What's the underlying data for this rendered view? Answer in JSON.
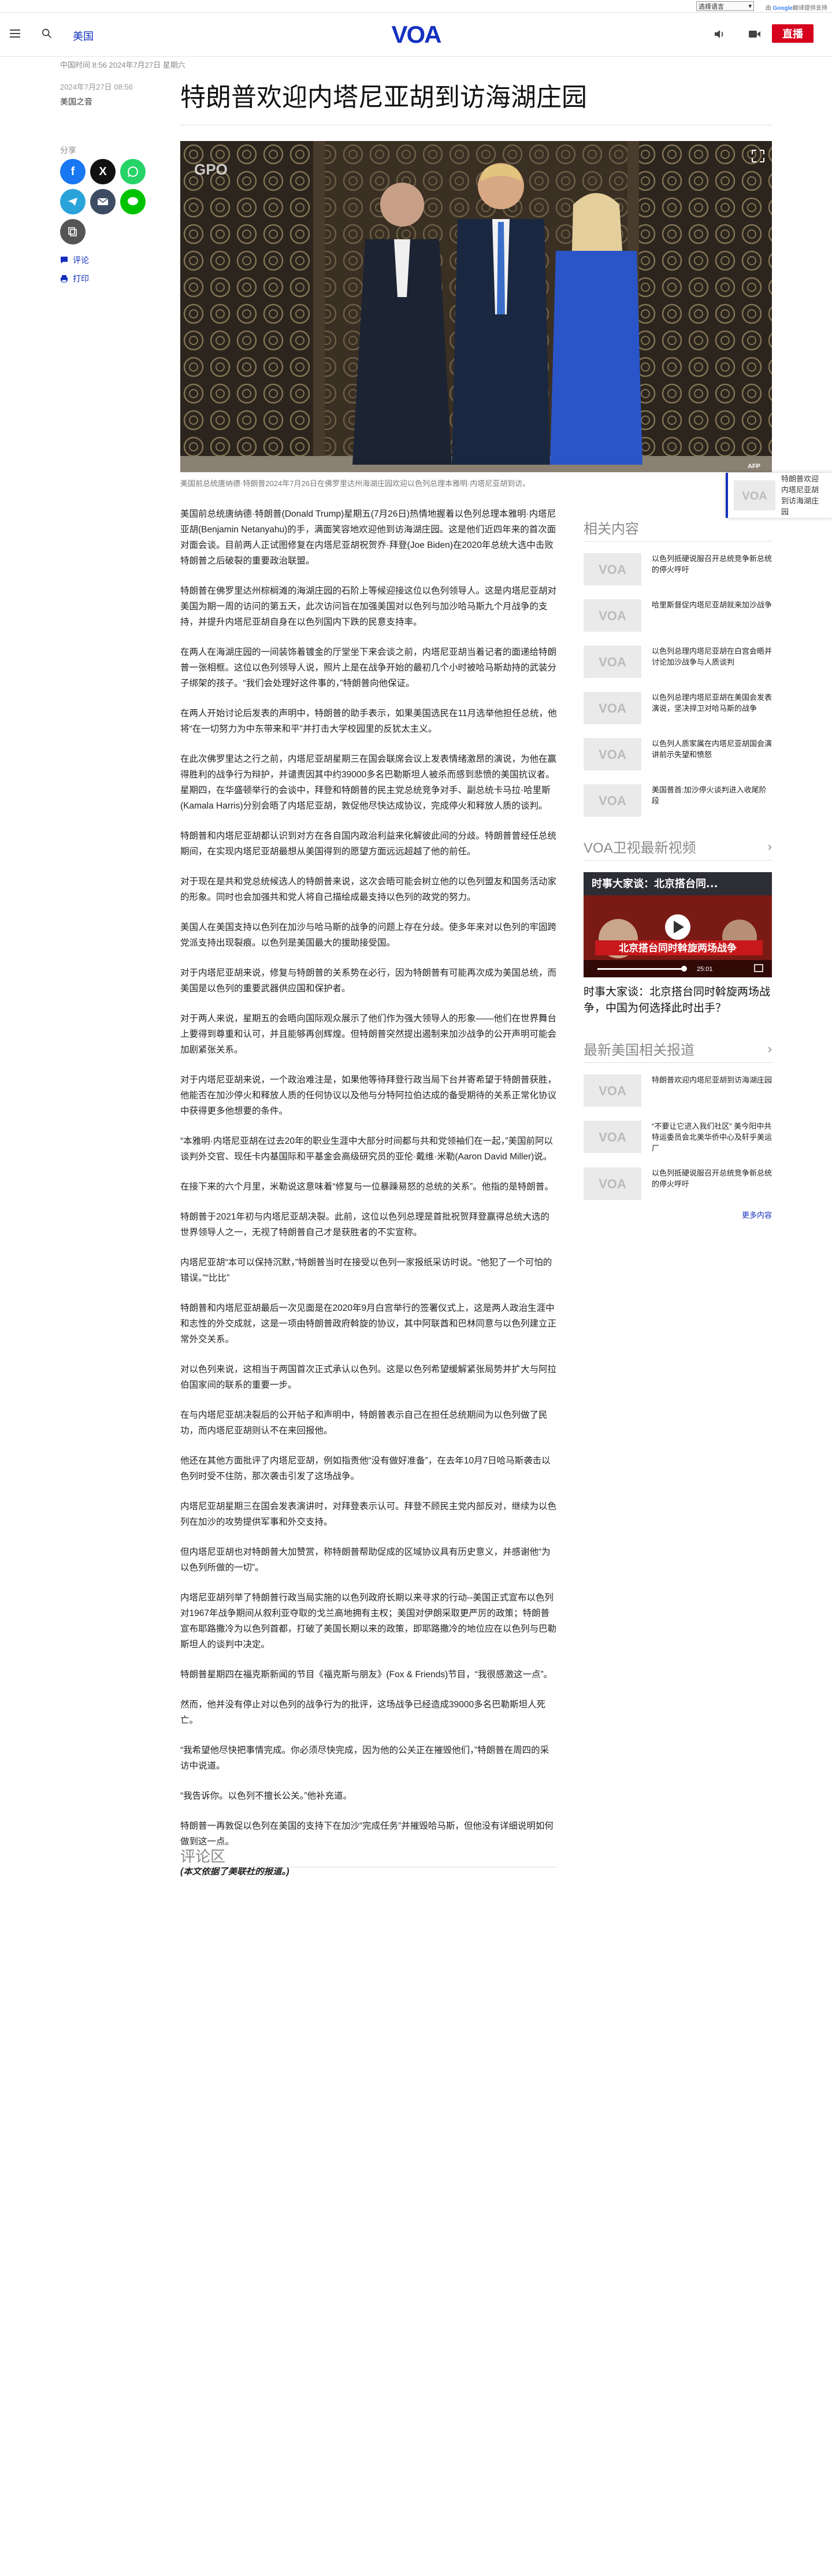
{
  "translate": {
    "select_label": "选择语言",
    "credit_prefix": "由",
    "credit_brand": "Google",
    "credit_suffix": "翻译提供支持"
  },
  "header": {
    "section": "美国",
    "logo": "VOA",
    "live_label": "直播"
  },
  "article": {
    "top_time": "中国时间 8:56 2024年7月27日 星期六",
    "date": "2024年7月27日 08:56",
    "author": "美国之音",
    "title": "特朗普欢迎内塔尼亚胡到访海湖庄园",
    "image_watermark": "GPO",
    "image_credit": "AFP",
    "caption": "美国前总统唐纳德·特朗普2024年7月26日在佛罗里达州海湖庄园欢迎以色列总理本雅明·内塔尼亚胡到访。",
    "paragraphs": [
      "美国前总统唐纳德·特朗普(Donald Trump)星期五(7月26日)热情地握着以色列总理本雅明·内塔尼亚胡(Benjamin Netanyahu)的手，满面笑容地欢迎他到访海湖庄园。这是他们近四年来的首次面对面会谈。目前两人正试图修复在内塔尼亚胡祝贺乔·拜登(Joe Biden)在2020年总统大选中击败特朗普之后破裂的重要政治联盟。",
      "特朗普在佛罗里达州棕榈滩的海湖庄园的石阶上等候迎接这位以色列领导人。这是内塔尼亚胡对美国为期一周的访问的第五天，此次访问旨在加强美国对以色列与加沙哈马斯九个月战争的支持，并提升内塔尼亚胡自身在以色列国内下跌的民意支持率。",
      "在两人在海湖庄园的一间装饰着镀金的厅堂坐下来会谈之前，内塔尼亚胡当着记者的面递给特朗普一张相框。这位以色列领导人说，照片上是在战争开始的最初几个小时被哈马斯劫持的武装分子绑架的孩子。“我们会处理好这件事的，”特朗普向他保证。",
      "在两人开始讨论后发表的声明中，特朗普的助手表示，如果美国选民在11月选举他担任总统，他将“在一切努力为中东带来和平”并打击大学校园里的反犹太主义。",
      "在此次佛罗里达之行之前，内塔尼亚胡星期三在国会联席会议上发表情绪激昂的演说，为他在赢得胜利的战争行为辩护，并谴责因其中约39000多名巴勒斯坦人被杀而感到悲愤的美国抗议者。星期四，在华盛顿举行的会谈中，拜登和特朗普的民主党总统竞争对手、副总统卡马拉·哈里斯(Kamala Harris)分别会晤了内塔尼亚胡，敦促他尽快达成协议，完成停火和释放人质的谈判。",
      "特朗普和内塔尼亚胡都认识到对方在各自国内政治利益来化解彼此间的分歧。特朗普曾经任总统期间，在实现内塔尼亚胡最想从美国得到的愿望方面远远超越了他的前任。",
      "对于现在是共和党总统候选人的特朗普来说，这次会晤可能会树立他的以色列盟友和国务活动家的形象。同时也会加强共和党人将自己描绘成最支持以色列的政党的努力。",
      "美国人在美国支持以色列在加沙与哈马斯的战争的问题上存在分歧。使多年来对以色列的牢固跨党派支持出现裂痕。以色列是美国最大的援助接受国。",
      "对于内塔尼亚胡来说，修复与特朗普的关系势在必行，因为特朗普有可能再次成为美国总统，而美国是以色列的重要武器供应国和保护者。",
      "对于两人来说，星期五的会晤向国际观众展示了他们作为强大领导人的形象——他们在世界舞台上要得到尊重和认可，并且能够再创辉煌。但特朗普突然提出遏制来加沙战争的公开声明可能会加剧紧张关系。",
      "对于内塔尼亚胡来说，一个政治难注是，如果他等待拜登行政当局下台并寄希望于特朗普获胜，他能否在加沙停火和释放人质的任何协议以及他与分特阿拉伯达成的备受期待的关系正常化协议中获得更多他想要的条件。",
      "“本雅明·内塔尼亚胡在过去20年的职业生涯中大部分时间都与共和党领袖们在一起，”美国前阿以谈判外交官、现任卡内基国际和平基金会高级研究员的亚伦·戴维·米勒(Aaron David Miller)说。",
      "在接下来的六个月里，米勒说这意味着“修复与一位暴躁易怒的总统的关系”。他指的是特朗普。",
      "特朗普于2021年初与内塔尼亚胡决裂。此前，这位以色列总理是首批祝贺拜登赢得总统大选的世界领导人之一，无视了特朗普自己才是获胜者的不实宣称。",
      "内塔尼亚胡“本可以保持沉默，”特朗普当时在接受以色列一家报纸采访时说。“他犯了一个可怕的错误。”“比比”",
      "特朗普和内塔尼亚胡最后一次见面是在2020年9月白宫举行的签署仪式上，这是两人政治生涯中和志性的外交成就，这是一项由特朗普政府斡旋的协议，其中阿联酋和巴林同意与以色列建立正常外交关系。",
      "对以色列来说，这相当于两国首次正式承认以色列。这是以色列希望缓解紧张局势并扩大与阿拉伯国家间的联系的重要一步。",
      "在与内塔尼亚胡决裂后的公开帖子和声明中，特朗普表示自己在担任总统期间为以色列做了民功，而内塔尼亚胡则认不在来回报他。",
      "他还在其他方面批评了内塔尼亚胡，例如指责他“没有做好准备”，在去年10月7日哈马斯袭击以色列时受不住防，那次袭击引发了这场战争。",
      "内塔尼亚胡星期三在国会发表演讲时，对拜登表示认可。拜登不顾民主党内部反对，继续为以色列在加沙的攻势提供军事和外交支持。",
      "但内塔尼亚胡也对特朗普大加赞赏，称特朗普帮助促成的区域协议具有历史意义，并感谢他“为以色列所做的一切”。",
      "内塔尼亚胡列举了特朗普行政当局实施的以色列政府长期以来寻求的行动--美国正式宣布以色列对1967年战争期间从叙利亚夺取的戈兰高地拥有主权；美国对伊朗采取更严厉的政策；特朗普宣布耶路撒冷为以色列首都，打破了美国长期以来的政策，即耶路撒冷的地位应在以色列与巴勒斯坦人的谈判中决定。",
      "特朗普星期四在福克斯新闻的节目《福克斯与朋友》(Fox & Friends)节目，“我很感激这一点”。",
      "然而，他并没有停止对以色列的战争行为的批评，这场战争已经造成39000多名巴勒斯坦人死亡。",
      "“我希望他尽快把事情完成。你必须尽快完成，因为他的公关正在摧毁他们，”特朗普在周四的采访中说道。",
      "“我告诉你。以色列不擅长公关。”他补充道。",
      "特朗普一再敦促以色列在美国的支持下在加沙“完成任务”并摧毁哈马斯，但他没有详细说明如何做到这一点。"
    ],
    "note": "(本文依据了美联社的报道。)",
    "comments_title": "评论区"
  },
  "share": {
    "label": "分享",
    "comment_link": "评论",
    "print_link": "打印"
  },
  "sidebar": {
    "related_title": "相关内容",
    "related": [
      "以色列抵硬说服召开总统竞争新总统的停火呼吁",
      "哈里斯督促内塔尼亚胡就来加沙战争",
      "以色列总理内塔尼亚胡在白宫会晤并讨论加沙战争与人质谈判",
      "以色列总理内塔尼亚胡在美国会发表演说，坚决捍卫对哈马斯的战争",
      "以色列人质家属在内塔尼亚胡国会演讲前示失望和愤怒",
      "美国普首:加沙停火谈判进入收尾阶段"
    ],
    "video_title": "VOA卫视最新视频",
    "video_overlay": "时事大家谈：北京搭台同...",
    "video_banner": "北京搭台同时斡旋两场战争",
    "video_time": "25:01",
    "video_caption": "时事大家谈：北京搭台同时斡旋两场战争，中国为何选择此时出手？",
    "latest_title": "最新美国相关报道",
    "latest": [
      "特朗普欢迎内塔尼亚胡到访海湖庄园",
      "“不要让它进入我们社区” 美今阳中共特运委员会北美华侨中心及轩乎美运厂",
      "以色列抵硬说服召开总统竞争新总统的停火呼吁"
    ],
    "more_label": "更多内容"
  },
  "float_card": {
    "text": "特朗普欢迎内塔尼亚胡到访海湖庄园"
  },
  "colors": {
    "brand": "#1330bf",
    "live": "#d6001c"
  }
}
